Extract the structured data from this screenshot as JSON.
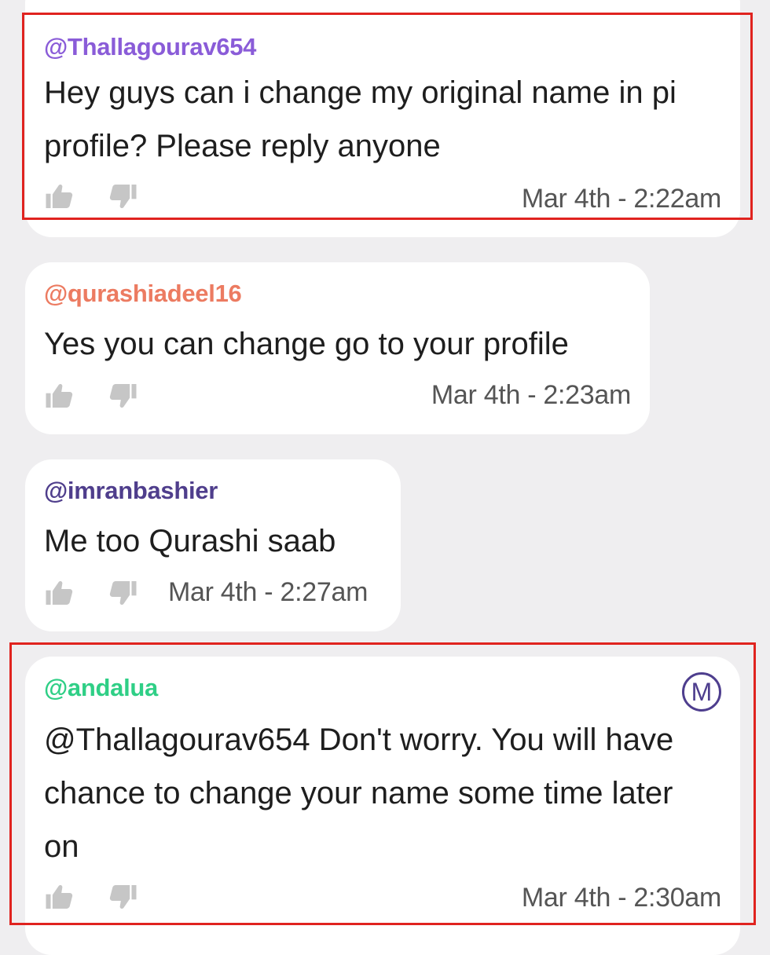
{
  "colors": {
    "background": "#efeef0",
    "bubble": "#ffffff",
    "highlight": "#e0231f",
    "icon": "#c6c6c6"
  },
  "comments": [
    {
      "username": "@Thallagourav654",
      "username_color": "#8a5cd8",
      "message": "Hey guys can i change my original name in pi profile? Please reply anyone",
      "timestamp": "Mar 4th - 2:22am",
      "highlighted": true
    },
    {
      "username": "@qurashiadeel16",
      "username_color": "#ec7b61",
      "message": "Yes you can change go to your profile",
      "timestamp": "Mar 4th - 2:23am",
      "highlighted": false
    },
    {
      "username": "@imranbashier",
      "username_color": "#4f3e8c",
      "message": "Me too Qurashi saab",
      "timestamp": "Mar 4th - 2:27am",
      "highlighted": false
    },
    {
      "username": "@andalua",
      "username_color": "#2fcf86",
      "badge": "M",
      "badge_icon": "moderator-badge-icon",
      "message": "@Thallagourav654 Don't worry. You will have chance to change your name some time later on",
      "timestamp": "Mar 4th - 2:30am",
      "highlighted": true
    }
  ],
  "icons": {
    "like": "thumbs-up-icon",
    "dislike": "thumbs-down-icon"
  }
}
